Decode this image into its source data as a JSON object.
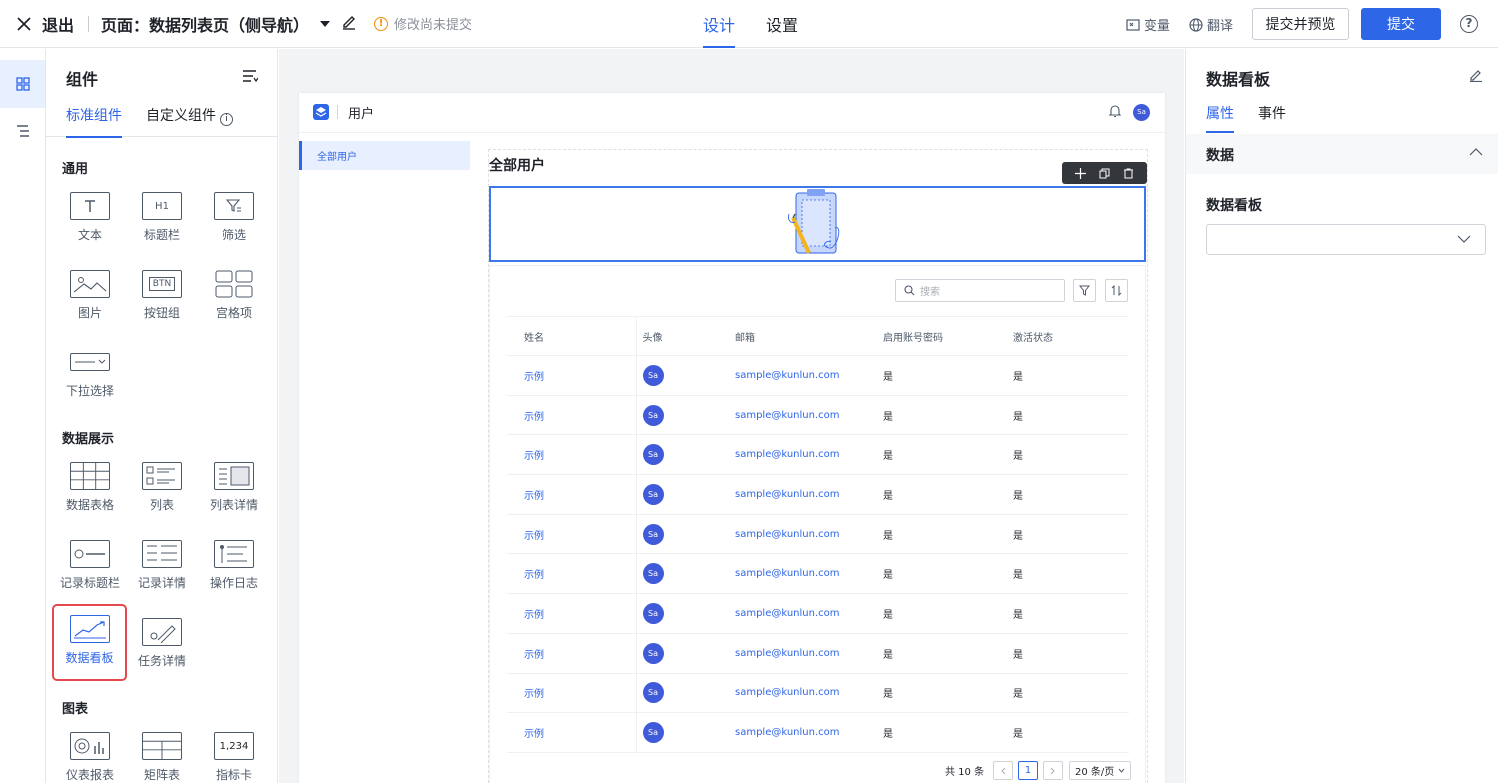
{
  "topbar": {
    "exit_label": "退出",
    "page_label": "页面：数据列表页（侧导航）",
    "unsaved_text": "修改尚未提交",
    "tabs": [
      {
        "label": "设计"
      },
      {
        "label": "设置"
      }
    ],
    "variables_label": "变量",
    "translate_label": "翻译",
    "preview_label": "提交并预览",
    "submit_label": "提交",
    "help_icon": "?"
  },
  "left_panel": {
    "title": "组件",
    "tabs": [
      {
        "label": "标准组件"
      },
      {
        "label": "自定义组件"
      }
    ],
    "info_icon": "i",
    "sections": [
      {
        "title": "通用",
        "items": [
          "文本",
          "标题栏",
          "筛选",
          "图片",
          "按钮组",
          "宫格项",
          "下拉选择"
        ]
      },
      {
        "title": "数据展示",
        "items": [
          "数据表格",
          "列表",
          "列表详情",
          "记录标题栏",
          "记录详情",
          "操作日志",
          "数据看板",
          "任务详情"
        ]
      },
      {
        "title": "图表",
        "items": [
          "仪表报表",
          "矩阵表",
          "指标卡"
        ]
      }
    ],
    "btn_icon_text": "BTN",
    "h1_icon_text": "H1",
    "kpi_icon_text": "1,234",
    "selected_item": "数据看板"
  },
  "canvas": {
    "app_name": "用户",
    "avatar_text": "Sa",
    "nav_item": "全部用户",
    "content_title": "全部用户",
    "search_placeholder": "搜索",
    "columns": [
      "姓名",
      "头像",
      "邮箱",
      "启用账号密码",
      "激活状态"
    ],
    "rows": [
      {
        "name": "示例",
        "avatar": "Sa",
        "email": "sample@kunlun.com",
        "pwd": "是",
        "active": "是"
      },
      {
        "name": "示例",
        "avatar": "Sa",
        "email": "sample@kunlun.com",
        "pwd": "是",
        "active": "是"
      },
      {
        "name": "示例",
        "avatar": "Sa",
        "email": "sample@kunlun.com",
        "pwd": "是",
        "active": "是"
      },
      {
        "name": "示例",
        "avatar": "Sa",
        "email": "sample@kunlun.com",
        "pwd": "是",
        "active": "是"
      },
      {
        "name": "示例",
        "avatar": "Sa",
        "email": "sample@kunlun.com",
        "pwd": "是",
        "active": "是"
      },
      {
        "name": "示例",
        "avatar": "Sa",
        "email": "sample@kunlun.com",
        "pwd": "是",
        "active": "是"
      },
      {
        "name": "示例",
        "avatar": "Sa",
        "email": "sample@kunlun.com",
        "pwd": "是",
        "active": "是"
      },
      {
        "name": "示例",
        "avatar": "Sa",
        "email": "sample@kunlun.com",
        "pwd": "是",
        "active": "是"
      },
      {
        "name": "示例",
        "avatar": "Sa",
        "email": "sample@kunlun.com",
        "pwd": "是",
        "active": "是"
      },
      {
        "name": "示例",
        "avatar": "Sa",
        "email": "sample@kunlun.com",
        "pwd": "是",
        "active": "是"
      }
    ],
    "pager": {
      "total": "共 10 条",
      "current_page": "1",
      "page_size": "20 条/页"
    }
  },
  "right_panel": {
    "title": "数据看板",
    "tabs": [
      {
        "label": "属性"
      },
      {
        "label": "事件"
      }
    ],
    "section_title": "数据",
    "field_label": "数据看板",
    "field_value": ""
  },
  "colors": {
    "accent": "#2e66e8",
    "selected_outline": "#e5484d",
    "warning": "#f08c00"
  }
}
